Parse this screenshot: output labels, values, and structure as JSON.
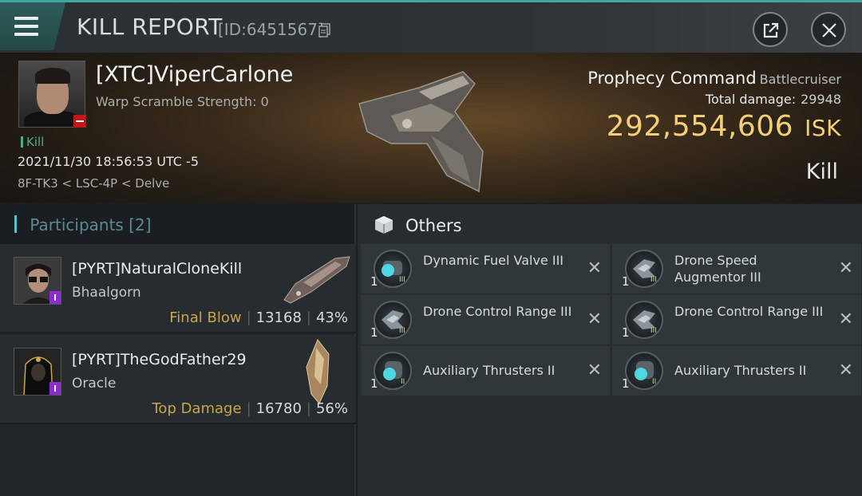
{
  "header": {
    "title": "KILL REPORT",
    "id_text": "[ID:6451567]"
  },
  "victim": {
    "name": "[XTC]ViperCarlone",
    "warp_scramble": "Warp Scramble Strength: 0",
    "tag": "Kill",
    "timestamp": "2021/11/30 18:56:53 UTC -5",
    "location": "8F-TK3 < LSC-4P < Delve",
    "ship_name": "Prophecy Command",
    "ship_class": "Battlecruiser",
    "total_damage_label": "Total damage:",
    "total_damage_value": "29948",
    "isk_value": "292,554,606",
    "isk_unit": "ISK",
    "result": "Kill"
  },
  "participants": {
    "label": "Participants",
    "count": "[2]",
    "items": [
      {
        "name": "[PYRT]NaturalCloneKill",
        "ship": "Bhaalgorn",
        "role": "Final Blow",
        "damage": "13168",
        "percent": "43%"
      },
      {
        "name": "[PYRT]TheGodFather29",
        "ship": "Oracle",
        "role": "Top Damage",
        "damage": "16780",
        "percent": "56%"
      }
    ]
  },
  "others": {
    "title": "Others",
    "items": [
      {
        "qty": "1",
        "name": "Dynamic Fuel Valve III",
        "icon": "fuel-valve-icon",
        "tier": "III"
      },
      {
        "qty": "1",
        "name": "Drone Speed Augmentor III",
        "icon": "drone-rig-icon",
        "tier": "III"
      },
      {
        "qty": "1",
        "name": "Drone Control Range III",
        "icon": "drone-rig-icon",
        "tier": "III"
      },
      {
        "qty": "1",
        "name": "Drone Control Range III",
        "icon": "drone-rig-icon",
        "tier": "III"
      },
      {
        "qty": "1",
        "name": "Auxiliary Thrusters II",
        "icon": "thruster-icon",
        "tier": "II"
      },
      {
        "qty": "1",
        "name": "Auxiliary Thrusters II",
        "icon": "thruster-icon",
        "tier": "II"
      }
    ]
  },
  "colors": {
    "accent": "#3fa8a0",
    "isk": "#f3cf7a",
    "role_label": "#c9a54a",
    "kill_tag": "#4fa98e",
    "alpha_badge": "#8b2bd6"
  }
}
